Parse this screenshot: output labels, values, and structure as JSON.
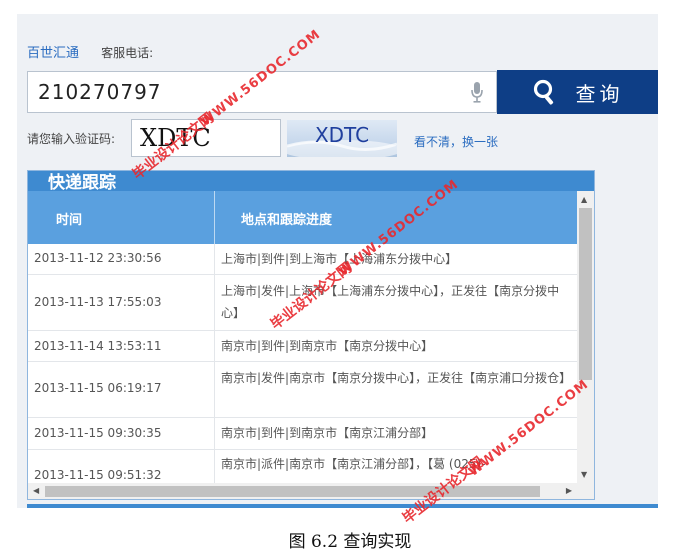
{
  "header": {
    "brand": "百世汇通",
    "hotline_label": "客服电话:"
  },
  "search": {
    "value": "210270797",
    "button_label": "查询"
  },
  "captcha": {
    "label": "请您输入验证码:",
    "input_value": "XDTC",
    "image_text": "XDTC",
    "refresh_label": "看不清，换一张"
  },
  "tracking": {
    "title": "快递跟踪",
    "columns": [
      "时间",
      "地点和跟踪进度"
    ],
    "rows": [
      {
        "time": "2013-11-12 23:30:56",
        "detail": "上海市|到件|到上海市【上海浦东分拨中心】"
      },
      {
        "time": "2013-11-13 17:55:03",
        "detail": "上海市|发件|上海市【上海浦东分拨中心】，正发往【南京分拨中心】"
      },
      {
        "time": "2013-11-14 13:53:11",
        "detail": "南京市|到件|到南京市【南京分拨中心】"
      },
      {
        "time": "2013-11-15 06:19:17",
        "detail": "南京市|发件|南京市【南京分拨中心】，正发往【南京浦口分拨仓】"
      },
      {
        "time": "2013-11-15 09:30:35",
        "detail": "南京市|到件|到南京市【南京江浦分部】"
      },
      {
        "time": "2013-11-15 09:51:32",
        "detail": "南京市|派件|南京市【南京江浦分部】，【葛  (025)-"
      }
    ]
  },
  "caption": "图  6.2  查询实现",
  "watermarks": {
    "cn": "毕业设计论文网",
    "url": "WWW.56DOC.COM"
  },
  "colors": {
    "search_button": "#0e3e86",
    "table_header": "#5aa0df",
    "link": "#2a6cc0",
    "watermark": "#e8292e"
  }
}
